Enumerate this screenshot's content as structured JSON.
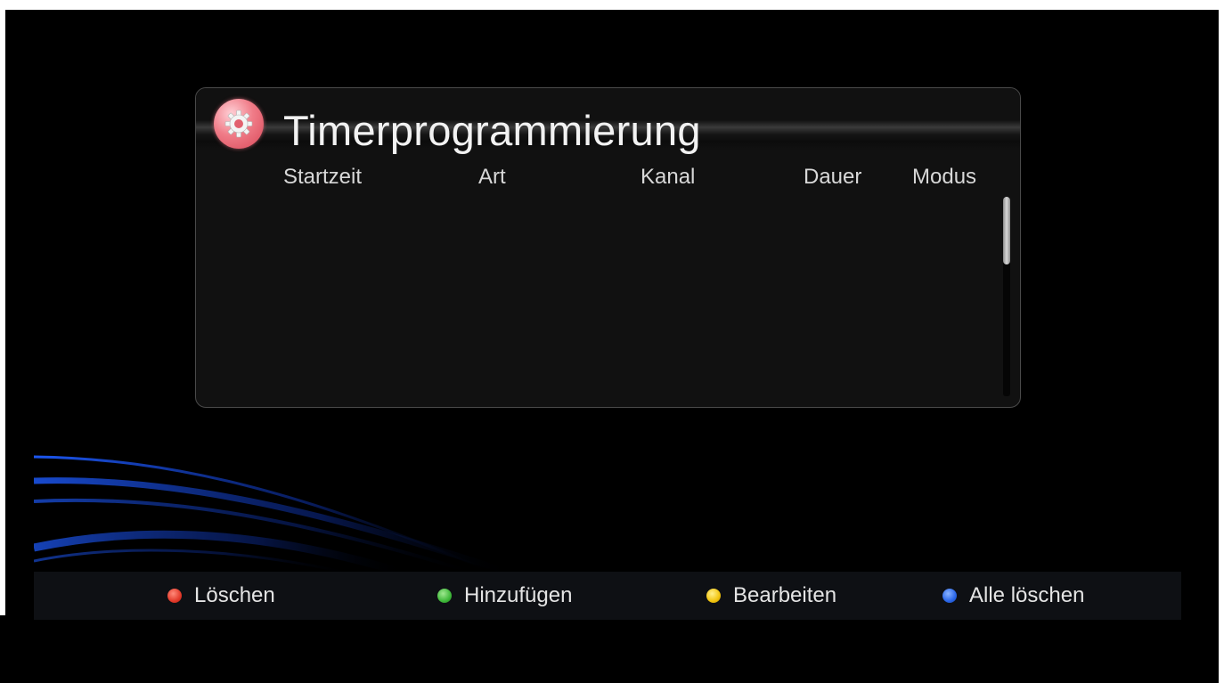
{
  "window": {
    "title": "Timerprogrammierung"
  },
  "icons": {
    "header": "gear-icon"
  },
  "columns": [
    "Startzeit",
    "Art",
    "Kanal",
    "Dauer",
    "Modus"
  ],
  "timers": [],
  "scrollbar": {
    "position": 0
  },
  "keys": [
    {
      "label": "Löschen",
      "color": "#e23a2a"
    },
    {
      "label": "Hinzufügen",
      "color": "#3fb83a"
    },
    {
      "label": "Bearbeiten",
      "color": "#f2c40e"
    },
    {
      "label": "Alle löschen",
      "color": "#2a66e8"
    }
  ]
}
